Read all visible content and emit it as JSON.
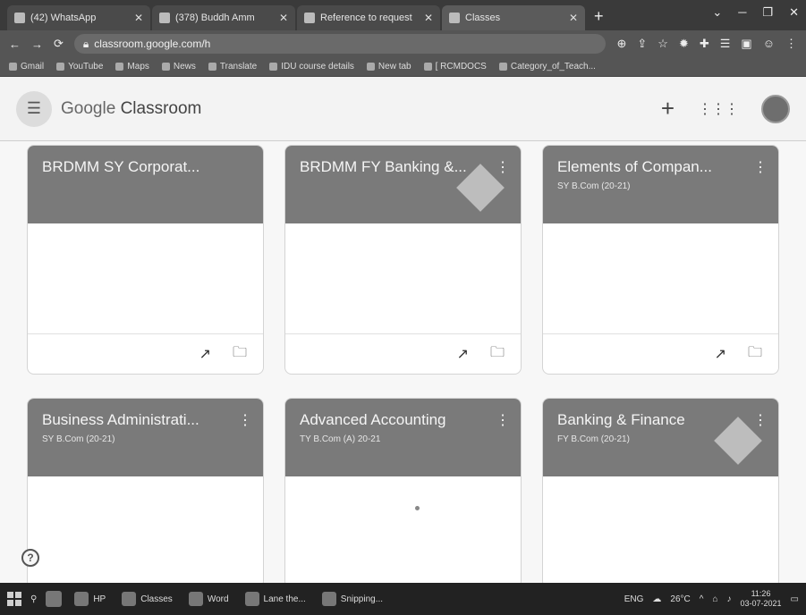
{
  "browser": {
    "tabs": [
      {
        "label": "(42) WhatsApp",
        "active": false
      },
      {
        "label": "(378) Buddh Amm",
        "active": false
      },
      {
        "label": "Reference to request",
        "active": false
      },
      {
        "label": "Classes",
        "active": true
      }
    ],
    "url": "classroom.google.com/h",
    "bookmarks": [
      "Gmail",
      "YouTube",
      "Maps",
      "News",
      "Translate",
      "IDU course details",
      "New tab",
      "[ RCMDOCS",
      "Category_of_Teach..."
    ]
  },
  "app": {
    "brand_google": "Google",
    "brand_classroom": "Classroom"
  },
  "cards": [
    {
      "title": "BRDMM SY Corporat...",
      "subtitle": ""
    },
    {
      "title": "BRDMM FY Banking &...",
      "subtitle": ""
    },
    {
      "title": "Elements of Compan...",
      "subtitle": "SY B.Com (20-21)"
    },
    {
      "title": "Business Administrati...",
      "subtitle": "SY B.Com (20-21)"
    },
    {
      "title": "Advanced Accounting",
      "subtitle": "TY B.Com (A) 20-21"
    },
    {
      "title": "Banking & Finance",
      "subtitle": "FY B.Com (20-21)"
    }
  ],
  "help_label": "?",
  "taskbar": {
    "items": [
      "HP",
      "Classes",
      "Word",
      "Lane the...",
      "Snipping..."
    ],
    "lang": "ENG",
    "weather": "26°C",
    "time": "11:26",
    "date": "03-07-2021"
  }
}
